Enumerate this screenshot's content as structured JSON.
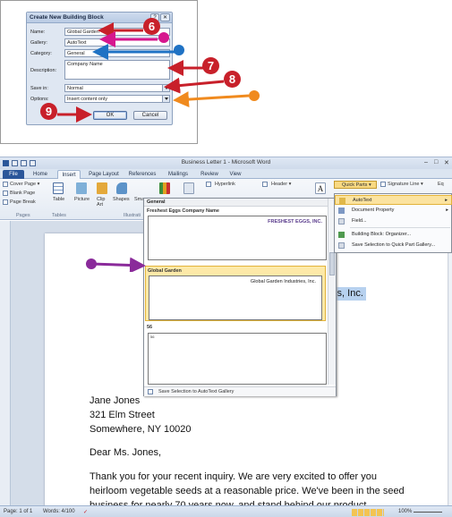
{
  "dialog": {
    "title": "Create New Building Block",
    "help_glyph": "?",
    "close_glyph": "✕",
    "fields": [
      {
        "label": "Name:",
        "value": "Global Garden"
      },
      {
        "label": "Gallery:",
        "value": "AutoText"
      },
      {
        "label": "Category:",
        "value": "General"
      },
      {
        "label": "Description:",
        "value": "Company Name"
      },
      {
        "label": "Save in:",
        "value": "Normal"
      },
      {
        "label": "Options:",
        "value": "Insert content only"
      }
    ],
    "ok_label": "OK",
    "cancel_label": "Cancel"
  },
  "callouts": {
    "six": "6",
    "seven": "7",
    "eight": "8",
    "nine": "9"
  },
  "callout_colors": {
    "red": "#c8202a",
    "magenta": "#d6178e",
    "blue": "#1f72c4",
    "orange": "#f08a1e",
    "purple": "#8a2a9a"
  },
  "word": {
    "window_title": "Business Letter 1 - Microsoft Word",
    "window_controls": [
      "–",
      "□",
      "✕"
    ],
    "tabs": [
      "File",
      "Home",
      "Insert",
      "Page Layout",
      "References",
      "Mailings",
      "Review",
      "View"
    ],
    "ribbon": {
      "pages_group": "Pages",
      "pages_items": [
        "Cover Page ▾",
        "Blank Page",
        "Page Break"
      ],
      "tables_group": "Tables",
      "table_label": "Table",
      "illustrations_items": [
        "Picture",
        "Clip Art",
        "Shapes",
        "Sma"
      ],
      "illustrations_group": "Illustrati",
      "hyperlink": "Hyperlink",
      "header": "Header ▾",
      "quick_parts": "Quick Parts ▾",
      "signature_line": "Signature Line ▾",
      "equation": "Eq"
    },
    "gallery": {
      "section_general": "General",
      "item1_title": "Freshest Eggs Company Name",
      "item1_preview": "FRESHEST EGGS, INC.",
      "item2_title": "Global Garden",
      "item2_preview": "Global Garden Industries, Inc.",
      "item3_title": "56",
      "item3_preview": "56",
      "footer": "Save Selection to AutoText Gallery"
    },
    "quick_parts_menu": [
      "AutoText",
      "Document Property",
      "Field...",
      "Building Block: Organizer...",
      "Save Selection to Quick Part Gallery..."
    ],
    "document": {
      "selected_fragment": "ies, Inc.",
      "address": [
        "Jane Jones",
        "321 Elm Street",
        "Somewhere, NY 10020"
      ],
      "salutation": "Dear Ms. Jones,",
      "body": [
        "Thank you for your recent inquiry. We are very excited to offer you",
        "heirloom vegetable seeds at a reasonable price. We've been in the seed",
        "business for nearly 70 years now, and stand behind our product."
      ]
    },
    "status": {
      "page": "Page: 1 of 1",
      "words": "Words: 4/100",
      "zoom": "100%"
    }
  }
}
